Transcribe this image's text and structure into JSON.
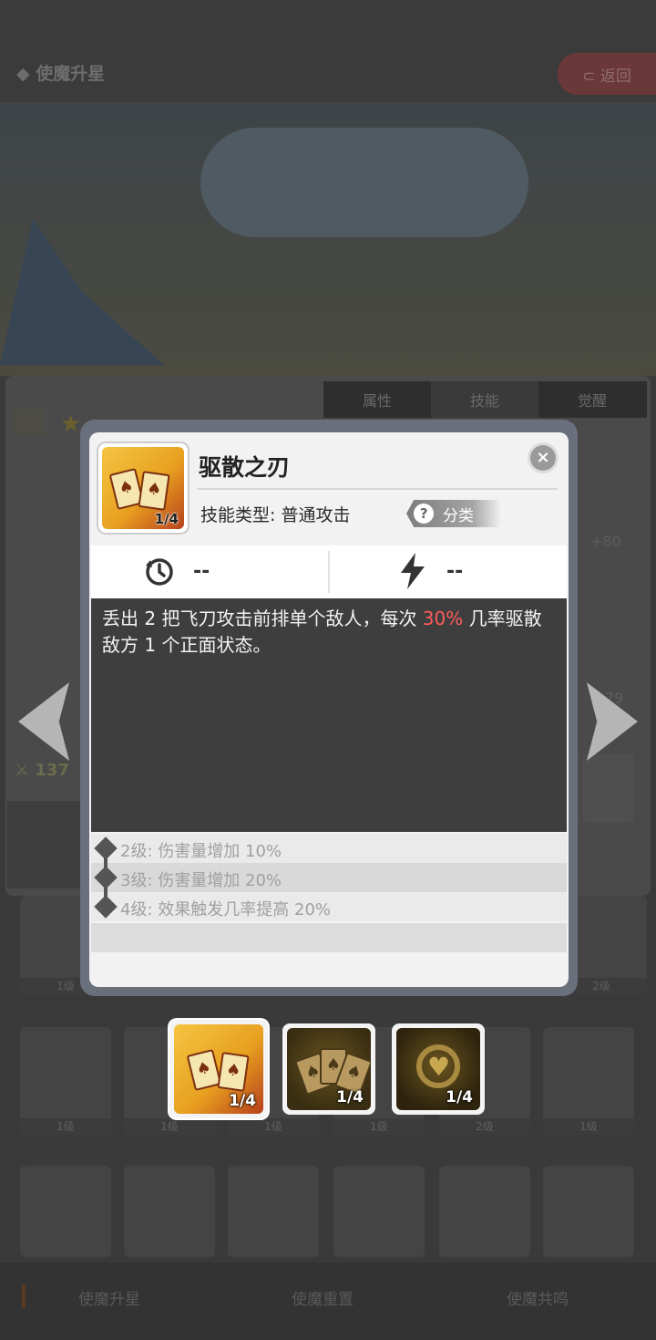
{
  "header": {
    "title": "◆ 使魔升星",
    "back_label": "⊂ 返回"
  },
  "background": {
    "tabs": [
      {
        "label": "属性"
      },
      {
        "label": "技能"
      },
      {
        "label": "觉醒"
      }
    ],
    "left_stat": "137",
    "right_stat_1": "+80",
    "right_stat_2": "79"
  },
  "roster": {
    "level_labels": [
      "1级",
      "1级",
      "1级",
      "1级",
      "2级",
      "1级"
    ],
    "top_left_level": "1级",
    "top_right_level": "2级"
  },
  "bottom_tabs": [
    {
      "label": "使魔升星"
    },
    {
      "label": "使魔重置"
    },
    {
      "label": "使魔共鸣"
    }
  ],
  "dialog": {
    "skill_name": "驱散之刃",
    "skill_type": "技能类型: 普通攻击",
    "category_label": "分类",
    "category_icon": "?",
    "icon_count": "1/4",
    "close_icon": "×",
    "cooldown_value": "--",
    "energy_value": "--",
    "description_before": "丢出 2 把飞刀攻击前排单个敌人，每次 ",
    "description_highlight": "30%",
    "description_after": " 几率驱散敌方 1 个正面状态。",
    "levels": [
      {
        "label": "2级:",
        "text": "伤害量增加 10%"
      },
      {
        "label": "3级:",
        "text": "伤害量增加 20%"
      },
      {
        "label": "4级:",
        "text": "效果触发几率提高 20%"
      }
    ]
  },
  "skill_selector": [
    {
      "count": "1/4",
      "selected": true
    },
    {
      "count": "1/4",
      "selected": false
    },
    {
      "count": "1/4",
      "selected": false
    }
  ],
  "colors": {
    "highlight": "#ff5a5a",
    "gold": "#e8a020"
  }
}
